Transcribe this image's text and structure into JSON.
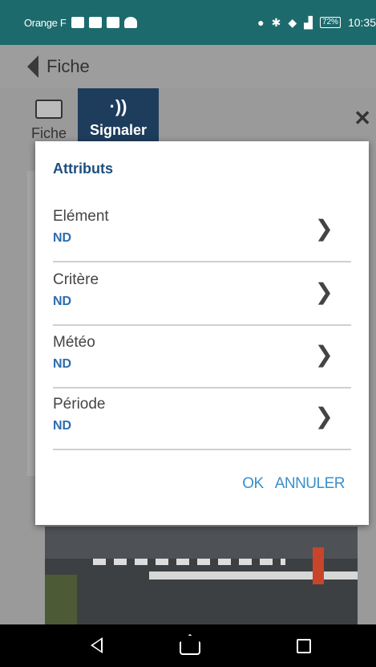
{
  "status_bar": {
    "carrier": "Orange F",
    "battery": "72%",
    "time": "10:35"
  },
  "app_bar": {
    "title": "Fiche"
  },
  "tabs": [
    {
      "label": "Fiche"
    },
    {
      "label": "Signaler"
    }
  ],
  "dialog": {
    "title": "Attributs",
    "rows": [
      {
        "label": "Elément",
        "value": "ND"
      },
      {
        "label": "Critère",
        "value": "ND"
      },
      {
        "label": "Météo",
        "value": "ND"
      },
      {
        "label": "Période",
        "value": "ND"
      }
    ],
    "ok_label": "OK",
    "cancel_label": "ANNULER"
  },
  "icons": [
    "back-arrow-icon",
    "id-card-icon",
    "nfc-signal-icon",
    "close-icon",
    "chevron-right-icon",
    "nav-back-icon",
    "nav-home-icon",
    "nav-recents-icon"
  ],
  "colors": {
    "status_bar": "#1d6a6c",
    "tab_active": "#1e3d5d",
    "accent": "#3a8fc9",
    "value": "#2d6db0"
  }
}
